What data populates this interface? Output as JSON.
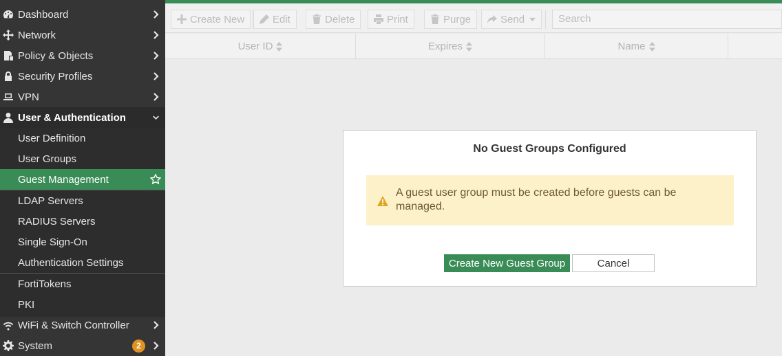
{
  "sidebar": {
    "items": [
      {
        "label": "Dashboard",
        "icon": "dashboard-icon"
      },
      {
        "label": "Network",
        "icon": "network-icon"
      },
      {
        "label": "Policy & Objects",
        "icon": "policy-icon"
      },
      {
        "label": "Security Profiles",
        "icon": "lock-icon"
      },
      {
        "label": "VPN",
        "icon": "laptop-icon"
      },
      {
        "label": "User & Authentication",
        "icon": "user-icon"
      },
      {
        "label": "User Definition"
      },
      {
        "label": "User Groups"
      },
      {
        "label": "Guest Management"
      },
      {
        "label": "LDAP Servers"
      },
      {
        "label": "RADIUS Servers"
      },
      {
        "label": "Single Sign-On"
      },
      {
        "label": "Authentication Settings"
      },
      {
        "label": "FortiTokens"
      },
      {
        "label": "PKI"
      },
      {
        "label": "WiFi & Switch Controller",
        "icon": "wifi-icon"
      },
      {
        "label": "System",
        "icon": "gear-icon",
        "badge": "2"
      }
    ],
    "accent_color": "#3a8c56",
    "badge_color": "#e09322"
  },
  "toolbar": {
    "create_new": "Create New",
    "edit": "Edit",
    "delete": "Delete",
    "print": "Print",
    "purge": "Purge",
    "send": "Send",
    "search_placeholder": "Search"
  },
  "table": {
    "columns": [
      "User ID",
      "Expires",
      "Name"
    ]
  },
  "dialog": {
    "title": "No Guest Groups Configured",
    "warning": "A guest user group must be created before guests can be managed.",
    "create_button": "Create New Guest Group",
    "cancel_button": "Cancel"
  }
}
